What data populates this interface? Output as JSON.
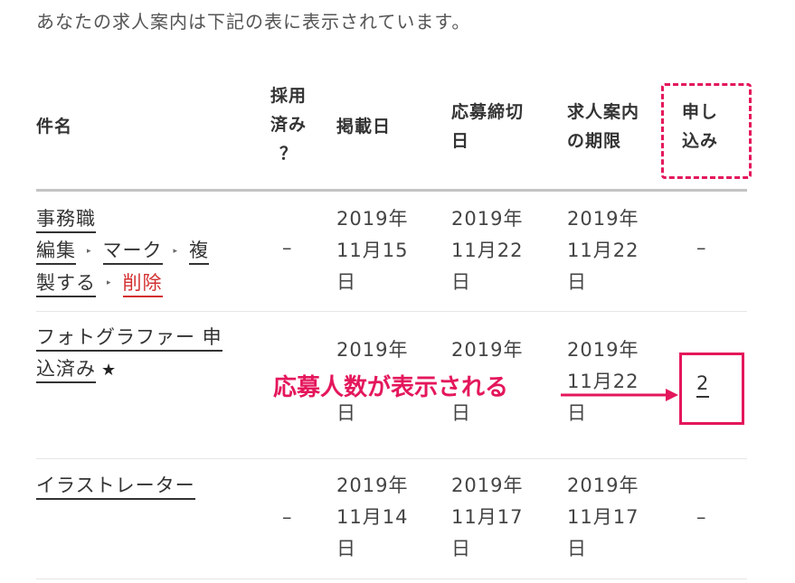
{
  "intro_text": "あなたの求人案内は下記の表に表示されています。",
  "headers": {
    "title": "件名",
    "hired": [
      "採用",
      "済み",
      "？"
    ],
    "posted": "掲載日",
    "deadline": [
      "応募締切",
      "日"
    ],
    "expiry": [
      "求人案内",
      "の期限"
    ],
    "applications": [
      "申し",
      "込み"
    ]
  },
  "rows": [
    {
      "title": "事務職",
      "actions": {
        "edit": "編集",
        "mark": "マーク",
        "dup_a": "複",
        "dup_b": "製する",
        "delete": "削除"
      },
      "hired": "–",
      "posted": [
        "2019年",
        "11月15",
        "日"
      ],
      "deadline": [
        "2019年",
        "11月22",
        "日"
      ],
      "expiry": [
        "2019年",
        "11月22",
        "日"
      ],
      "applications": "–"
    },
    {
      "title_a": "フォトグラファー 申",
      "title_b": "込済み",
      "star": "★",
      "posted": [
        "2019年",
        "",
        "日"
      ],
      "deadline": [
        "2019年",
        "",
        "日"
      ],
      "expiry": [
        "2019年",
        "11月22",
        "日"
      ],
      "applications": "2"
    },
    {
      "title": "イラストレーター",
      "hired": "–",
      "posted": [
        "2019年",
        "11月14",
        "日"
      ],
      "deadline": [
        "2019年",
        "11月17",
        "日"
      ],
      "expiry": [
        "2019年",
        "11月17",
        "日"
      ],
      "applications": "–"
    }
  ],
  "annotation": {
    "label": "応募人数が表示される",
    "color": "#e4175b"
  }
}
